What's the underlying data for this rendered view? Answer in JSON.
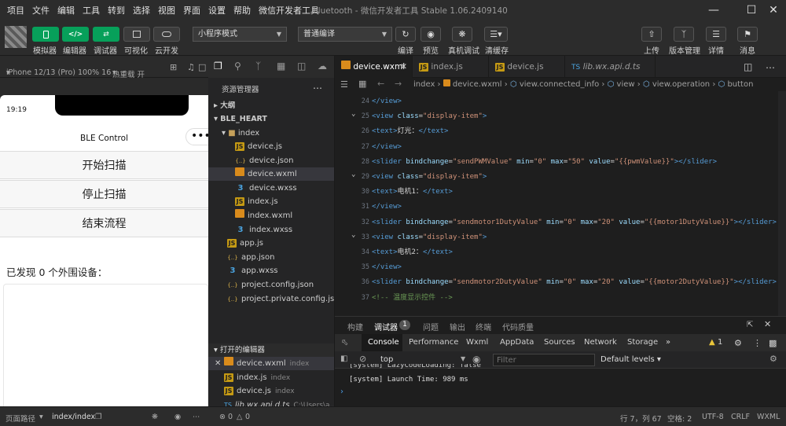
{
  "menubar": {
    "items": [
      "项目",
      "文件",
      "编辑",
      "工具",
      "转到",
      "选择",
      "视图",
      "界面",
      "设置",
      "帮助",
      "微信开发者工具"
    ],
    "window_title": "bluetooth - 微信开发者工具 Stable 1.06.2409140"
  },
  "toolbar": {
    "left_buttons": [
      "模拟器",
      "编辑器",
      "调试器",
      "可视化",
      "云开发"
    ],
    "mode_select": "小程序模式",
    "compile_select": "普通编译",
    "mid_buttons": [
      "编译",
      "预览",
      "真机调试",
      "清缓存"
    ],
    "right_buttons": [
      "上传",
      "版本管理",
      "详情",
      "消息"
    ]
  },
  "simulator": {
    "device": "iPhone 12/13 (Pro) 100% 16",
    "hot_reload": "热重载 开",
    "time": "19:19",
    "nav_title": "BLE Control",
    "buttons": [
      "开始扫描",
      "停止扫描",
      "结束流程"
    ],
    "found_text": "已发现 0 个外围设备："
  },
  "explorer": {
    "title": "资源管理器",
    "outline": "大纲",
    "project": "BLE_HEART",
    "folder": "index",
    "files": [
      {
        "name": "device.js",
        "type": "js"
      },
      {
        "name": "device.json",
        "type": "json"
      },
      {
        "name": "device.wxml",
        "type": "wxml"
      },
      {
        "name": "device.wxss",
        "type": "wxss"
      },
      {
        "name": "index.js",
        "type": "js"
      },
      {
        "name": "index.wxml",
        "type": "wxml"
      },
      {
        "name": "index.wxss",
        "type": "wxss"
      }
    ],
    "root_files": [
      {
        "name": "app.js",
        "type": "js"
      },
      {
        "name": "app.json",
        "type": "json"
      },
      {
        "name": "app.wxss",
        "type": "wxss"
      },
      {
        "name": "project.config.json",
        "type": "json"
      },
      {
        "name": "project.private.config.js...",
        "type": "json"
      }
    ],
    "opened_editors_title": "打开的编辑器",
    "opened": [
      {
        "name": "device.wxml",
        "dir": "index"
      },
      {
        "name": "index.js",
        "dir": "index"
      },
      {
        "name": "device.js",
        "dir": "index"
      },
      {
        "name": "lib.wx.api.d.ts",
        "dir": "C:\\Users\\a..."
      }
    ]
  },
  "editor": {
    "tabs": [
      "device.wxml",
      "index.js",
      "device.js",
      "lib.wx.api.d.ts"
    ],
    "breadcrumb": [
      "index",
      "device.wxml",
      "view.connected_info",
      "view",
      "view.operation",
      "button"
    ],
    "lines": [
      {
        "n": "24",
        "code": "</view>"
      },
      {
        "n": "25",
        "code": "<view class=\"display-item\">"
      },
      {
        "n": "26",
        "code": "  <text>灯光：</text>"
      },
      {
        "n": "27",
        "code": "</view>"
      },
      {
        "n": "28",
        "code": "<slider bindchange=\"sendPWMValue\" min=\"0\" max=\"50\" value=\"{{pwmValue}}\"></slider>"
      },
      {
        "n": "29",
        "code": "<view class=\"display-item\">"
      },
      {
        "n": "30",
        "code": "  <text>电机1：</text>"
      },
      {
        "n": "31",
        "code": "</view>"
      },
      {
        "n": "32",
        "code": "<slider bindchange=\"sendmotor1DutyValue\" min=\"0\" max=\"20\" value=\"{{motor1DutyValue}}\"></slider>"
      },
      {
        "n": "33",
        "code": "<view class=\"display-item\">"
      },
      {
        "n": "34",
        "code": "  <text>电机2：</text>"
      },
      {
        "n": "35",
        "code": "</view>"
      },
      {
        "n": "36",
        "code": "<slider bindchange=\"sendmotor2DutyValue\" min=\"0\" max=\"20\" value=\"{{motor2DutyValue}}\"></slider>"
      },
      {
        "n": "37",
        "code": "<!-- 温度显示控件 -->"
      }
    ]
  },
  "panel": {
    "tabs": [
      "构建",
      "调试器",
      "问题",
      "输出",
      "终端",
      "代码质量"
    ],
    "debugger_badge": "1",
    "devtools_tabs": [
      "Console",
      "Performance",
      "Wxml",
      "AppData",
      "Sources",
      "Network",
      "Storage"
    ],
    "warning_count": "1",
    "context": "top",
    "filter_placeholder": "Filter",
    "levels": "Default levels",
    "log_lines": [
      "[system] LazyCodeLoading: false",
      "[system] Launch Time: 989 ms"
    ]
  },
  "statusbar": {
    "page_path_label": "页面路径",
    "page_path": "index/index",
    "errors": "0",
    "warnings": "0",
    "position": "行 7，列 67",
    "spaces": "空格: 2",
    "encoding": "UTF-8",
    "eol": "CRLF",
    "language": "WXML"
  },
  "colors": {
    "accent_green": "#07a05a",
    "bg": "#1e1e1e",
    "toolbar": "#2c2c2c"
  }
}
